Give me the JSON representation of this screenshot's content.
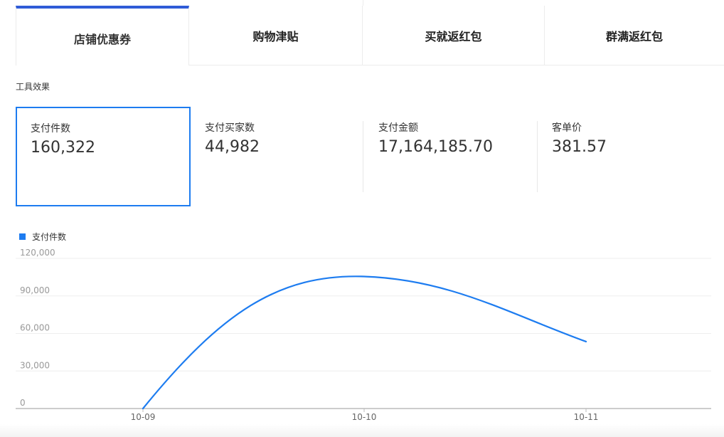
{
  "tabs": [
    {
      "label": "店铺优惠券",
      "active": true
    },
    {
      "label": "购物津贴",
      "active": false
    },
    {
      "label": "买就返红包",
      "active": false
    },
    {
      "label": "群满返红包",
      "active": false
    }
  ],
  "section_title": "工具效果",
  "metrics": [
    {
      "label": "支付件数",
      "value": "160,322",
      "selected": true
    },
    {
      "label": "支付买家数",
      "value": "44,982",
      "selected": false
    },
    {
      "label": "支付金额",
      "value": "17,164,185.70",
      "selected": false
    },
    {
      "label": "客单价",
      "value": "381.57",
      "selected": false
    }
  ],
  "colors": {
    "accent": "#1d7cf0",
    "tab_active": "#2f5bd7"
  },
  "chart_data": {
    "type": "line",
    "title": "",
    "xlabel": "",
    "ylabel": "",
    "legend": "top-left",
    "grid": true,
    "categories": [
      "10-09",
      "10-10",
      "10-11"
    ],
    "ylim": [
      0,
      120000
    ],
    "yticks": [
      0,
      30000,
      60000,
      90000,
      120000
    ],
    "ytick_labels": [
      "0",
      "30,000",
      "60,000",
      "90,000",
      "120,000"
    ],
    "series": [
      {
        "name": "支付件数",
        "color": "#1d7cf0",
        "values": [
          0,
          105500,
          53500
        ],
        "smooth": true
      }
    ]
  }
}
